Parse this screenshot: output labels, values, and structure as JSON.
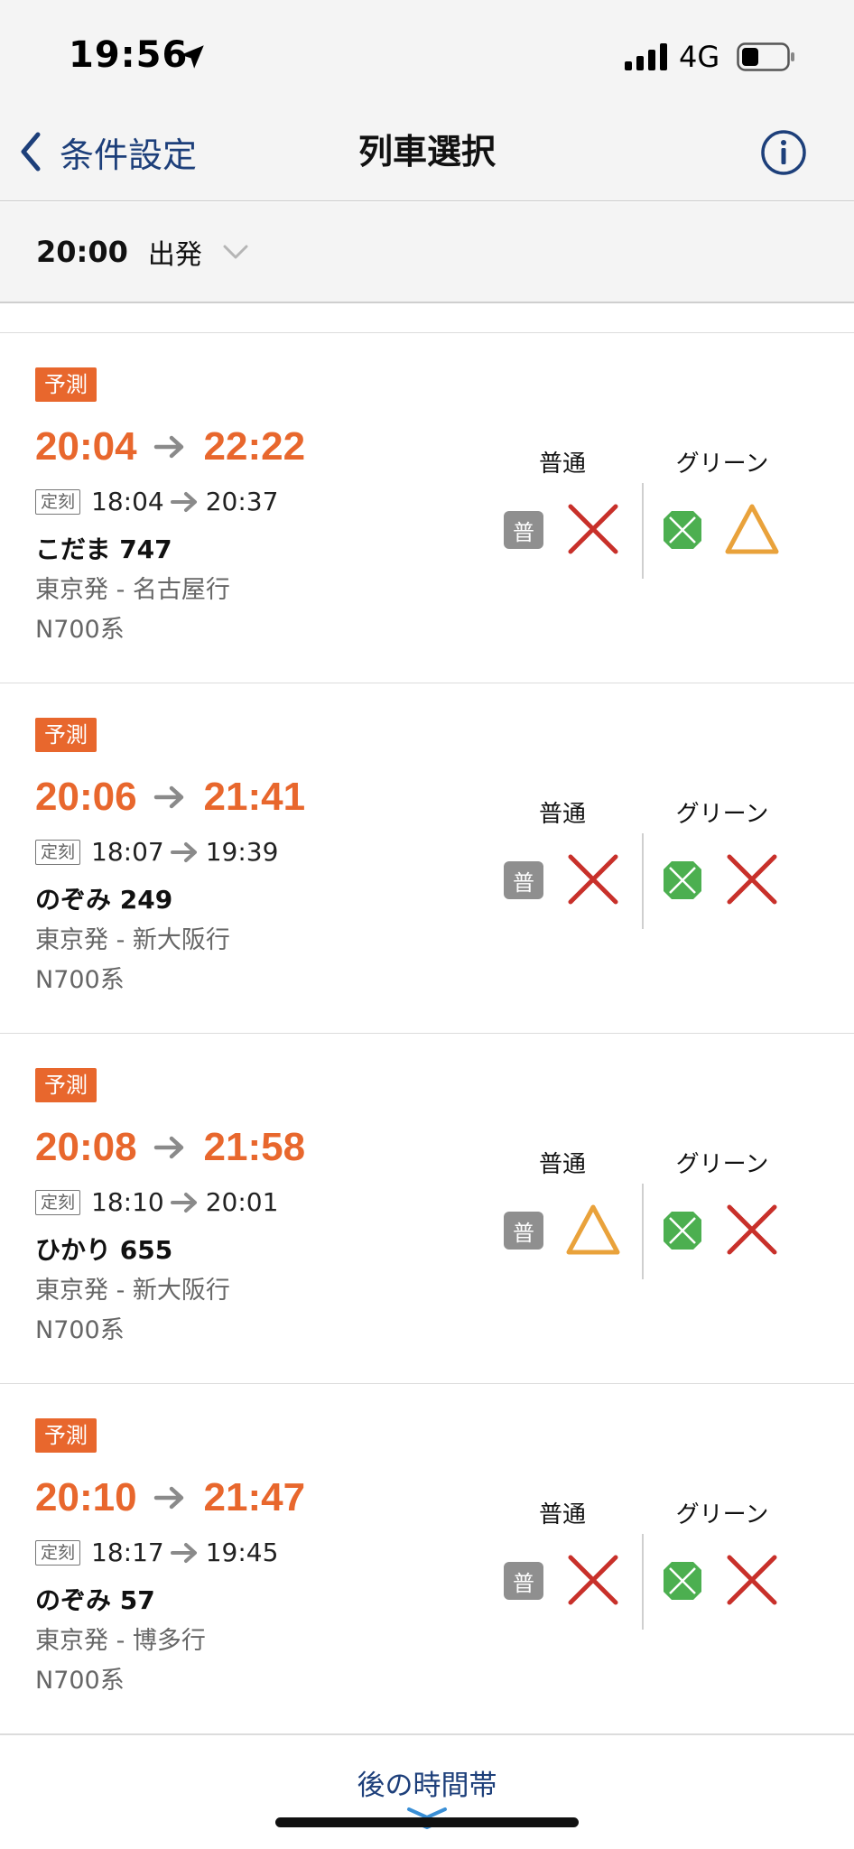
{
  "status_bar": {
    "time": "19:56",
    "network": "4G"
  },
  "nav": {
    "back_label": "条件設定",
    "title": "列車選択"
  },
  "time_filter": {
    "time": "20:00",
    "mode": "出発"
  },
  "columns": {
    "ordinary": "普通",
    "green": "グリーン",
    "ordinary_icon_label": "普"
  },
  "trains": [
    {
      "badge": "予測",
      "pred_dep": "20:04",
      "pred_arr": "22:22",
      "sched_label": "定刻",
      "sched_dep": "18:04",
      "sched_arr": "20:37",
      "name": "こだま 747",
      "route": "東京発 - 名古屋行",
      "type": "N700系",
      "ordinary": "×",
      "green": "△"
    },
    {
      "badge": "予測",
      "pred_dep": "20:06",
      "pred_arr": "21:41",
      "sched_label": "定刻",
      "sched_dep": "18:07",
      "sched_arr": "19:39",
      "name": "のぞみ 249",
      "route": "東京発 - 新大阪行",
      "type": "N700系",
      "ordinary": "×",
      "green": "×"
    },
    {
      "badge": "予測",
      "pred_dep": "20:08",
      "pred_arr": "21:58",
      "sched_label": "定刻",
      "sched_dep": "18:10",
      "sched_arr": "20:01",
      "name": "ひかり 655",
      "route": "東京発 - 新大阪行",
      "type": "N700系",
      "ordinary": "△",
      "green": "×"
    },
    {
      "badge": "予測",
      "pred_dep": "20:10",
      "pred_arr": "21:47",
      "sched_label": "定刻",
      "sched_dep": "18:17",
      "sched_arr": "19:45",
      "name": "のぞみ 57",
      "route": "東京発 - 博多行",
      "type": "N700系",
      "ordinary": "×",
      "green": "×"
    }
  ],
  "footer": {
    "later_label": "後の時間帯"
  },
  "colors": {
    "predicted": "#e8672d",
    "nav_blue": "#1d3f7a",
    "cross": "#c8302a",
    "triangle": "#e9a23b",
    "green_icon": "#4caf50"
  }
}
